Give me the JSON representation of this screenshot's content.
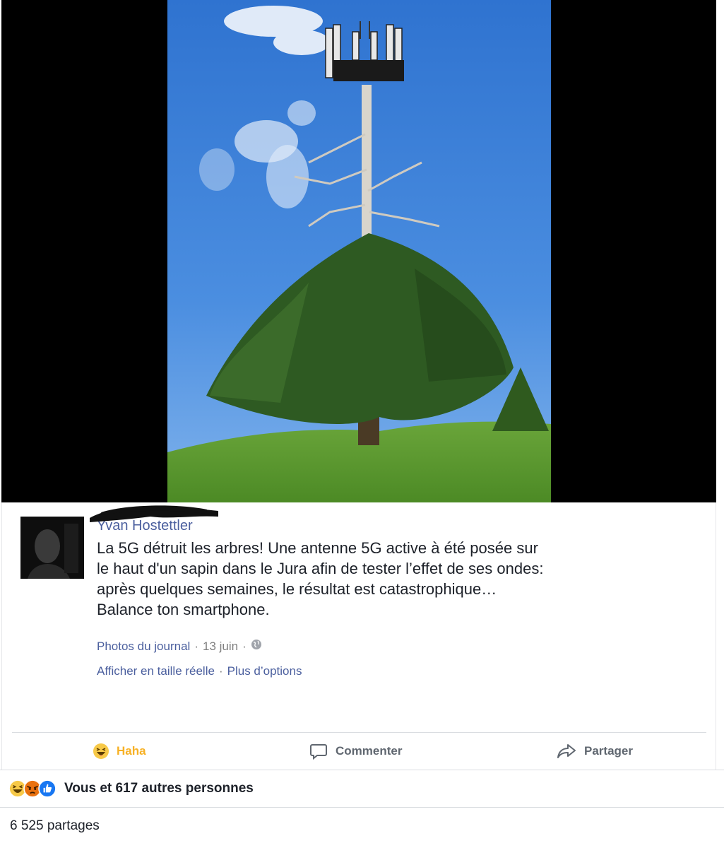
{
  "post": {
    "author": "Yvan Hostettler",
    "text_lines": [
      "La 5G détruit les arbres! Une antenne 5G active à été posée sur",
      "le haut d'un sapin dans le Jura afin de tester l’effet de ses ondes:",
      "après quelques semaines, le résultat est catastrophique…",
      "Balance ton smartphone."
    ],
    "album": "Photos du journal",
    "separator": "·",
    "date": "13 juin",
    "privacy_icon": "globe-icon",
    "view_full_size": "Afficher en taille réelle",
    "more_options": "Plus d’options"
  },
  "actions": {
    "haha": "Haha",
    "comment": "Commenter",
    "share": "Partager"
  },
  "reactions": {
    "icons": [
      "haha-icon",
      "angry-icon",
      "like-icon"
    ],
    "summary": "Vous et 617 autres personnes"
  },
  "shares": "6 525 partages",
  "colors": {
    "link": "#4b5f9e",
    "haha": "#f7b125",
    "like": "#1877f2",
    "viewer_bg": "#000000"
  }
}
